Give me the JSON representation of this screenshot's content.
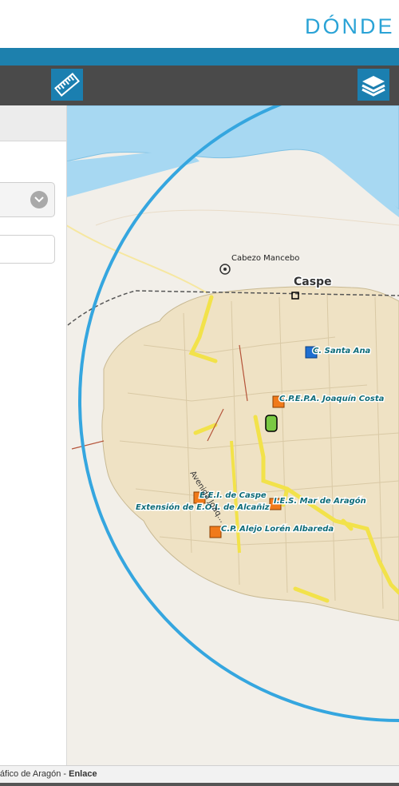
{
  "header": {
    "title": "DÓNDE V"
  },
  "toolbar": {
    "measure_icon": "ruler-icon",
    "layers_icon": "layers-icon"
  },
  "map": {
    "labels": {
      "cabezo": "Cabezo Mancebo",
      "caspe": "Caspe",
      "santa_ana": "C. Santa Ana",
      "cpepa": "C.P.E.P.A. Joaquín Costa",
      "eei": "E.E.I. de Caspe",
      "eoi": "Extensión de E.O.I. de Alcañiz",
      "ies": "I.E.S. Mar de Aragón",
      "cp_alejo": "C.P. Alejo Lorén Albareda",
      "avenida": "Avenida Joaq..."
    }
  },
  "footer": {
    "attribution": "ográfico de Aragón - ",
    "link": "Enlace"
  },
  "colors": {
    "brand_blue": "#2aa3d6",
    "toolbar_blue": "#1b7fb0",
    "school_orange": "#f07a1a",
    "school_blue": "#1f6fd1",
    "buffer_circle": "#35a6df",
    "river": "#a7d8f2",
    "urban": "#efe2c4",
    "road_yellow": "#f2e24a"
  }
}
